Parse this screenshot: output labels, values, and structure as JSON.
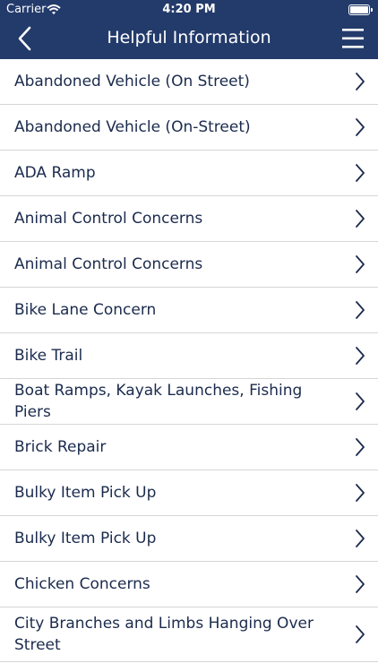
{
  "status_bar": {
    "carrier": "Carrier",
    "time": "4:20 PM"
  },
  "header": {
    "title": "Helpful Information"
  },
  "icons": {
    "back": "chevron-left-icon",
    "menu": "hamburger-menu-icon",
    "row": "chevron-right-icon",
    "wifi": "wifi-icon",
    "battery": "battery-icon"
  },
  "colors": {
    "header_bg": "#233b6b",
    "text": "#1b2b4d",
    "divider": "#d6d6d6"
  },
  "list": {
    "items": [
      {
        "label": "Abandoned Vehicle (On Street)"
      },
      {
        "label": "Abandoned Vehicle (On-Street)"
      },
      {
        "label": "ADA Ramp"
      },
      {
        "label": "Animal Control Concerns"
      },
      {
        "label": "Animal Control Concerns"
      },
      {
        "label": "Bike Lane Concern"
      },
      {
        "label": "Bike Trail"
      },
      {
        "label": "Boat Ramps, Kayak Launches, Fishing Piers"
      },
      {
        "label": "Brick Repair"
      },
      {
        "label": "Bulky Item Pick Up"
      },
      {
        "label": "Bulky Item Pick Up"
      },
      {
        "label": "Chicken Concerns"
      },
      {
        "label": "City Branches and Limbs Hanging Over Street"
      }
    ]
  }
}
